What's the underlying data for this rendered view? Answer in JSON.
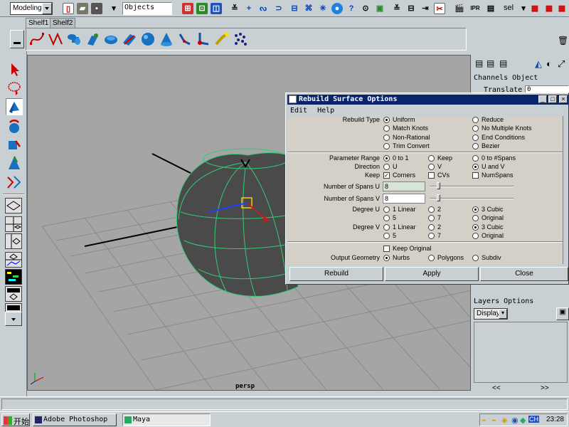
{
  "status_line": {
    "mode": "Modeling",
    "selection_field": "Objects",
    "sel_label": "sel"
  },
  "shelf": {
    "tabs": [
      "Shelf1",
      "Shelf2"
    ],
    "icons": [
      "curve-tool-icon",
      "ep-curve-icon",
      "nurbs-cylinder-icon",
      "loft-icon",
      "revolve-icon",
      "planar-icon",
      "sphere-icon",
      "cone-icon",
      "ik-handle-icon",
      "joint-icon",
      "light-icon",
      "particle-icon"
    ]
  },
  "channel_box": {
    "title": "Channels  Object",
    "attr_label": "Translate Y",
    "attr_value": "0"
  },
  "layers": {
    "title": "Layers  Options",
    "display_value": "Display",
    "nav_left": "<<",
    "nav_right": ">>"
  },
  "viewport": {
    "camera": "persp"
  },
  "dialog": {
    "title": "Rebuild Surface Options",
    "menu": [
      "Edit",
      "Help"
    ],
    "rebuild_type": {
      "label": "Rebuild Type",
      "options": [
        "Uniform",
        "Reduce",
        "Match Knots",
        "No Multiple Knots",
        "Non-Rational",
        "End Conditions",
        "Trim Convert",
        "Bezier"
      ],
      "selected": "Uniform"
    },
    "parameter_range": {
      "label": "Parameter Range",
      "options": [
        "0 to 1",
        "Keep",
        "0 to #Spans"
      ],
      "selected": "0 to 1"
    },
    "direction": {
      "label": "Direction",
      "options": [
        "U",
        "V",
        "U and V"
      ],
      "selected": "U and V"
    },
    "keep": {
      "label": "Keep",
      "options": [
        "Corners",
        "CVs",
        "NumSpans"
      ],
      "checked": [
        "Corners"
      ]
    },
    "spans_u": {
      "label": "Number of Spans U",
      "value": "8"
    },
    "spans_v": {
      "label": "Number of Spans V",
      "value": "8"
    },
    "degree_u": {
      "label": "Degree U",
      "options": [
        "1 Linear",
        "2",
        "3 Cubic",
        "5",
        "7",
        "Original"
      ],
      "selected": "3 Cubic"
    },
    "degree_v": {
      "label": "Degree V",
      "options": [
        "1 Linear",
        "2",
        "3 Cubic",
        "5",
        "7",
        "Original"
      ],
      "selected": "3 Cubic"
    },
    "keep_original": {
      "label": "Keep Original",
      "checked": false
    },
    "output_geometry": {
      "label": "Output Geometry",
      "options": [
        "Nurbs",
        "Polygons",
        "Subdiv"
      ],
      "selected": "Nurbs"
    },
    "buttons": {
      "rebuild": "Rebuild",
      "apply": "Apply",
      "close": "Close"
    }
  },
  "taskbar": {
    "start": "开始",
    "tasks": [
      "Adobe Photoshop",
      "Maya"
    ],
    "clock": "23:28"
  }
}
